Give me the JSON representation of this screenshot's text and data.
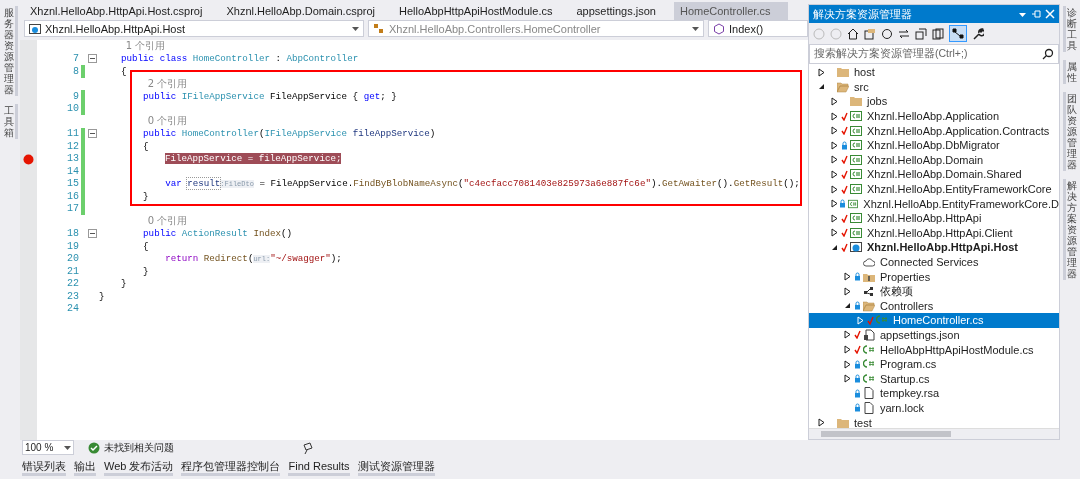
{
  "left_strip": [
    "服务器资源管理器",
    "工具箱"
  ],
  "tabs": [
    {
      "label": "Xhznl.HelloAbp.HttpApi.Host.csproj",
      "selected": false
    },
    {
      "label": "Xhznl.HelloAbp.Domain.csproj",
      "selected": false
    },
    {
      "label": "HelloAbpHttpApiHostModule.cs",
      "selected": false
    },
    {
      "label": "appsettings.json",
      "selected": false
    },
    {
      "label": "HomeController.cs",
      "selected": true
    }
  ],
  "nav": {
    "project": "Xhznl.HelloAbp.HttpApi.Host",
    "type": "Xhznl.HelloAbp.Controllers.HomeController",
    "member": "Index()"
  },
  "code": [
    {
      "kind": "lens",
      "text": "1 个引用"
    },
    {
      "kind": "code",
      "number": "7",
      "fold": true,
      "changed": false,
      "breakpoint": false,
      "tokens": [
        {
          "kind": "kw",
          "text": "    public class "
        },
        {
          "kind": "type",
          "text": "HomeController"
        },
        {
          "kind": "plain",
          "text": " : "
        },
        {
          "kind": "type",
          "text": "AbpController"
        }
      ]
    },
    {
      "kind": "code",
      "number": "8",
      "fold": false,
      "changed": true,
      "breakpoint": false,
      "tokens": [
        {
          "kind": "plain",
          "text": "    {"
        }
      ]
    },
    {
      "kind": "lens",
      "text": "2 个引用"
    },
    {
      "kind": "code",
      "number": "9",
      "fold": false,
      "changed": true,
      "breakpoint": false,
      "tokens": [
        {
          "kind": "kw",
          "text": "        public "
        },
        {
          "kind": "type",
          "text": "IFileAppService"
        },
        {
          "kind": "plain",
          "text": " FileAppService { "
        },
        {
          "kind": "kw",
          "text": "get"
        },
        {
          "kind": "plain",
          "text": "; }"
        }
      ]
    },
    {
      "kind": "code",
      "number": "10",
      "fold": false,
      "changed": true,
      "breakpoint": false
    },
    {
      "kind": "lens",
      "text": "0 个引用"
    },
    {
      "kind": "code",
      "number": "11",
      "fold": true,
      "changed": true,
      "breakpoint": false,
      "tokens": [
        {
          "kind": "kw",
          "text": "        public "
        },
        {
          "kind": "type",
          "text": "HomeController"
        },
        {
          "kind": "plain",
          "text": "("
        },
        {
          "kind": "type",
          "text": "IFileAppService "
        },
        {
          "kind": "param",
          "text": "fileAppService"
        },
        {
          "kind": "plain",
          "text": ")"
        }
      ]
    },
    {
      "kind": "code",
      "number": "12",
      "fold": false,
      "changed": true,
      "breakpoint": false,
      "tokens": [
        {
          "kind": "plain",
          "text": "        {"
        }
      ]
    },
    {
      "kind": "code",
      "number": "13",
      "fold": false,
      "changed": true,
      "breakpoint": true,
      "tokens": [
        {
          "kind": "breakpoint",
          "text": "FileAppService = fileAppService;"
        }
      ]
    },
    {
      "kind": "code",
      "number": "14",
      "fold": false,
      "changed": true,
      "breakpoint": false
    },
    {
      "kind": "code",
      "number": "15",
      "fold": false,
      "changed": true,
      "breakpoint": false,
      "tokens": [
        {
          "kind": "kw",
          "text": "            var "
        },
        {
          "kind": "boxed",
          "text": "result"
        },
        {
          "kind": "inlay",
          "text": ":FileDto"
        },
        {
          "kind": "plain",
          "text": " = FileAppService."
        },
        {
          "kind": "method",
          "text": "FindByBlobNameAsync"
        },
        {
          "kind": "plain",
          "text": "("
        },
        {
          "kind": "string",
          "text": "\"c4ecfacc7081403e825973a6e887fc6e\""
        },
        {
          "kind": "plain",
          "text": ")."
        },
        {
          "kind": "method",
          "text": "GetAwaiter"
        },
        {
          "kind": "plain",
          "text": "()."
        },
        {
          "kind": "method",
          "text": "GetResult"
        },
        {
          "kind": "plain",
          "text": "();"
        }
      ]
    },
    {
      "kind": "code",
      "number": "16",
      "fold": false,
      "changed": true,
      "breakpoint": false,
      "tokens": [
        {
          "kind": "plain",
          "text": "        }"
        }
      ]
    },
    {
      "kind": "code",
      "number": "17",
      "fold": false,
      "changed": true,
      "breakpoint": false
    },
    {
      "kind": "lens",
      "text": "0 个引用"
    },
    {
      "kind": "code",
      "number": "18",
      "fold": true,
      "changed": false,
      "breakpoint": false,
      "tokens": [
        {
          "kind": "kw",
          "text": "        public "
        },
        {
          "kind": "type",
          "text": "ActionResult"
        },
        {
          "kind": "method",
          "text": " Index"
        },
        {
          "kind": "plain",
          "text": "()"
        }
      ]
    },
    {
      "kind": "code",
      "number": "19",
      "fold": false,
      "changed": false,
      "breakpoint": false,
      "tokens": [
        {
          "kind": "plain",
          "text": "        {"
        }
      ]
    },
    {
      "kind": "code",
      "number": "20",
      "fold": false,
      "changed": false,
      "breakpoint": false,
      "tokens": [
        {
          "kind": "control",
          "text": "            return "
        },
        {
          "kind": "method",
          "text": "Redirect"
        },
        {
          "kind": "plain",
          "text": "("
        },
        {
          "kind": "inlay",
          "text": "url:"
        },
        {
          "kind": "string",
          "text": "\"~/swagger\""
        },
        {
          "kind": "plain",
          "text": ");"
        }
      ]
    },
    {
      "kind": "code",
      "number": "21",
      "fold": false,
      "changed": false,
      "breakpoint": false,
      "tokens": [
        {
          "kind": "plain",
          "text": "        }"
        }
      ]
    },
    {
      "kind": "code",
      "number": "22",
      "fold": false,
      "changed": false,
      "breakpoint": false,
      "tokens": [
        {
          "kind": "plain",
          "text": "    }"
        }
      ]
    },
    {
      "kind": "code",
      "number": "23",
      "fold": false,
      "changed": false,
      "breakpoint": false,
      "tokens": [
        {
          "kind": "plain",
          "text": "}"
        }
      ]
    },
    {
      "kind": "code",
      "number": "24",
      "fold": false,
      "changed": false,
      "breakpoint": false
    }
  ],
  "annotation_frame": true,
  "status": {
    "zoom": "100 %",
    "issues": "未找到相关问题"
  },
  "bottom_tabs": [
    "错误列表",
    "输出",
    "Web 发布活动",
    "程序包管理器控制台",
    "Find Results",
    "测试资源管理器"
  ],
  "solution_explorer": {
    "title": "解决方案资源管理器",
    "search_placeholder": "搜索解决方案资源管理器(Ctrl+;)",
    "tree": [
      {
        "label": "host",
        "kind": "folder",
        "expanded": false,
        "selected": false
      },
      {
        "label": "src",
        "kind": "folder",
        "expanded": true,
        "selected": false,
        "children": [
          {
            "label": "jobs",
            "kind": "folder",
            "expanded": false,
            "selected": false
          },
          {
            "label": "Xhznl.HelloAbp.Application",
            "kind": "project",
            "checked": true,
            "locked": false,
            "expanded": false,
            "selected": false
          },
          {
            "label": "Xhznl.HelloAbp.Application.Contracts",
            "kind": "project",
            "checked": true,
            "locked": false,
            "expanded": false,
            "selected": false
          },
          {
            "label": "Xhznl.HelloAbp.DbMigrator",
            "kind": "project",
            "checked": false,
            "locked": true,
            "expanded": false,
            "selected": false
          },
          {
            "label": "Xhznl.HelloAbp.Domain",
            "kind": "project",
            "checked": true,
            "locked": false,
            "expanded": false,
            "selected": false
          },
          {
            "label": "Xhznl.HelloAbp.Domain.Shared",
            "kind": "project",
            "checked": true,
            "locked": false,
            "expanded": false,
            "selected": false
          },
          {
            "label": "Xhznl.HelloAbp.EntityFrameworkCore",
            "kind": "project",
            "checked": true,
            "locked": false,
            "expanded": false,
            "selected": false
          },
          {
            "label": "Xhznl.HelloAbp.EntityFrameworkCore.D",
            "kind": "project",
            "checked": false,
            "locked": true,
            "expanded": false,
            "selected": false
          },
          {
            "label": "Xhznl.HelloAbp.HttpApi",
            "kind": "project",
            "checked": true,
            "locked": false,
            "expanded": false,
            "selected": false
          },
          {
            "label": "Xhznl.HelloAbp.HttpApi.Client",
            "kind": "project",
            "checked": true,
            "locked": false,
            "expanded": false,
            "selected": false
          },
          {
            "label": "Xhznl.HelloAbp.HttpApi.Host",
            "kind": "webproject",
            "checked": true,
            "locked": false,
            "expanded": true,
            "selected": false,
            "children": [
              {
                "label": "Connected Services",
                "kind": "services",
                "selected": false
              },
              {
                "label": "Properties",
                "kind": "properties",
                "checked": false,
                "locked": true,
                "expanded": false,
                "selected": false
              },
              {
                "label": "依赖项",
                "kind": "dependencies",
                "expanded": false,
                "selected": false
              },
              {
                "label": "Controllers",
                "kind": "folder",
                "checked": false,
                "locked": true,
                "expanded": true,
                "selected": false,
                "children": [
                  {
                    "label": "HomeController.cs",
                    "kind": "csharp",
                    "checked": true,
                    "locked": false,
                    "expanded": false,
                    "selected": true
                  }
                ]
              },
              {
                "label": "appsettings.json",
                "kind": "json",
                "checked": true,
                "locked": false,
                "expanded": false,
                "selected": false
              },
              {
                "label": "HelloAbpHttpApiHostModule.cs",
                "kind": "csharp",
                "checked": true,
                "locked": false,
                "expanded": false,
                "selected": false
              },
              {
                "label": "Program.cs",
                "kind": "csharp",
                "checked": false,
                "locked": true,
                "expanded": false,
                "selected": false
              },
              {
                "label": "Startup.cs",
                "kind": "csharp",
                "checked": false,
                "locked": true,
                "expanded": false,
                "selected": false
              },
              {
                "label": "tempkey.rsa",
                "kind": "file",
                "checked": false,
                "locked": true,
                "selected": false
              },
              {
                "label": "yarn.lock",
                "kind": "file",
                "checked": false,
                "locked": true,
                "selected": false
              }
            ]
          }
        ]
      },
      {
        "label": "test",
        "kind": "folder",
        "expanded": false,
        "selected": false
      }
    ]
  },
  "right_strip": [
    "诊断工具",
    "属性",
    "团队资源管理器",
    "解决方案资源管理器"
  ]
}
